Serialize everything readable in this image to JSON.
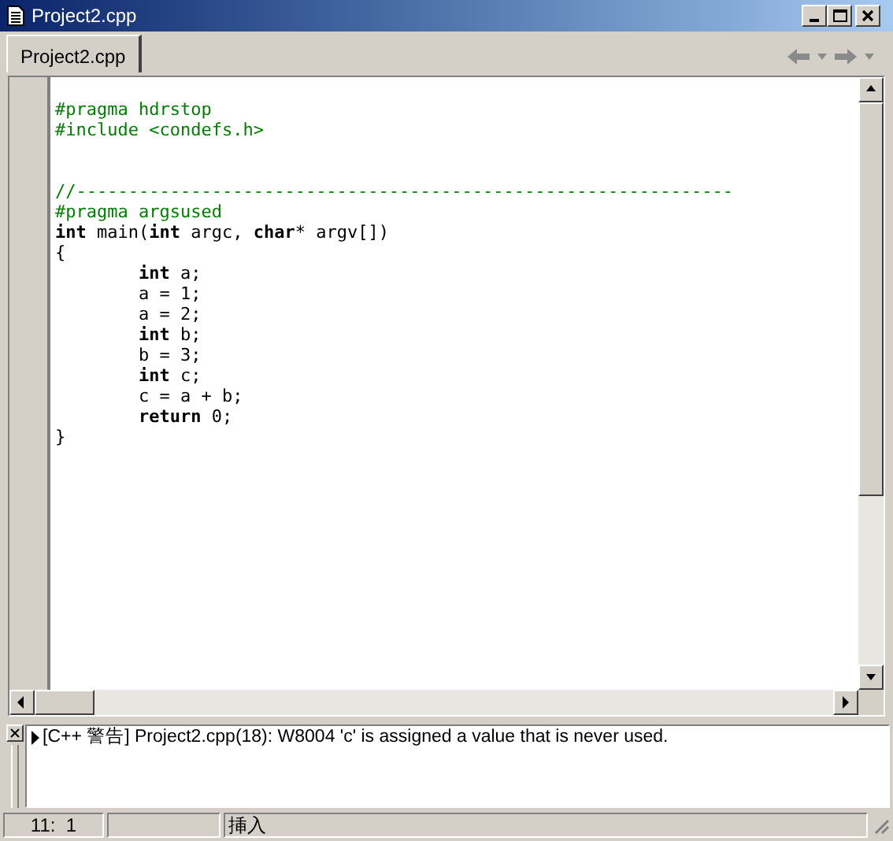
{
  "window": {
    "title": "Project2.cpp"
  },
  "tabs": [
    {
      "label": "Project2.cpp",
      "selected": true
    }
  ],
  "editor": {
    "lines": [
      {
        "kind": "code",
        "tokens": [
          {
            "kind": "directive",
            "text": "#pragma hdrstop"
          }
        ]
      },
      {
        "kind": "code",
        "tokens": [
          {
            "kind": "directive",
            "text": "#include <condefs.h>"
          }
        ]
      },
      {
        "kind": "blank"
      },
      {
        "kind": "blank"
      },
      {
        "kind": "code",
        "tokens": [
          {
            "kind": "comment",
            "text": "//---------------------------------------------------------------"
          }
        ]
      },
      {
        "kind": "code",
        "tokens": [
          {
            "kind": "directive",
            "text": "#pragma argsused"
          }
        ]
      },
      {
        "kind": "code",
        "tokens": [
          {
            "kind": "keyword",
            "text": "int"
          },
          {
            "kind": "plain",
            "text": " main("
          },
          {
            "kind": "keyword",
            "text": "int"
          },
          {
            "kind": "plain",
            "text": " argc, "
          },
          {
            "kind": "keyword",
            "text": "char"
          },
          {
            "kind": "plain",
            "text": "* argv[])"
          }
        ]
      },
      {
        "kind": "code",
        "tokens": [
          {
            "kind": "plain",
            "text": "{"
          }
        ]
      },
      {
        "kind": "code",
        "tokens": [
          {
            "kind": "keyword",
            "text": "\tint"
          },
          {
            "kind": "plain",
            "text": " a;"
          }
        ]
      },
      {
        "kind": "code",
        "tokens": [
          {
            "kind": "plain",
            "text": "\ta = 1;"
          }
        ]
      },
      {
        "kind": "code",
        "tokens": [
          {
            "kind": "plain",
            "text": "\ta = 2;"
          }
        ]
      },
      {
        "kind": "code",
        "tokens": [
          {
            "kind": "keyword",
            "text": "\tint"
          },
          {
            "kind": "plain",
            "text": " b;"
          }
        ]
      },
      {
        "kind": "code",
        "tokens": [
          {
            "kind": "plain",
            "text": "\tb = 3;"
          }
        ]
      },
      {
        "kind": "code",
        "tokens": [
          {
            "kind": "keyword",
            "text": "\tint"
          },
          {
            "kind": "plain",
            "text": " c;"
          }
        ]
      },
      {
        "kind": "code",
        "tokens": [
          {
            "kind": "plain",
            "text": "\tc = a + b;"
          }
        ]
      },
      {
        "kind": "code",
        "tokens": [
          {
            "kind": "keyword",
            "text": "\treturn"
          },
          {
            "kind": "plain",
            "text": " 0;"
          }
        ]
      },
      {
        "kind": "code",
        "tokens": [
          {
            "kind": "plain",
            "text": "}"
          }
        ]
      }
    ]
  },
  "messages": [
    {
      "text": "[C++ 警告] Project2.cpp(18): W8004 'c' is assigned a value that is never used."
    }
  ],
  "status_bar": {
    "position": "11:  1",
    "mode": "挿入"
  }
}
